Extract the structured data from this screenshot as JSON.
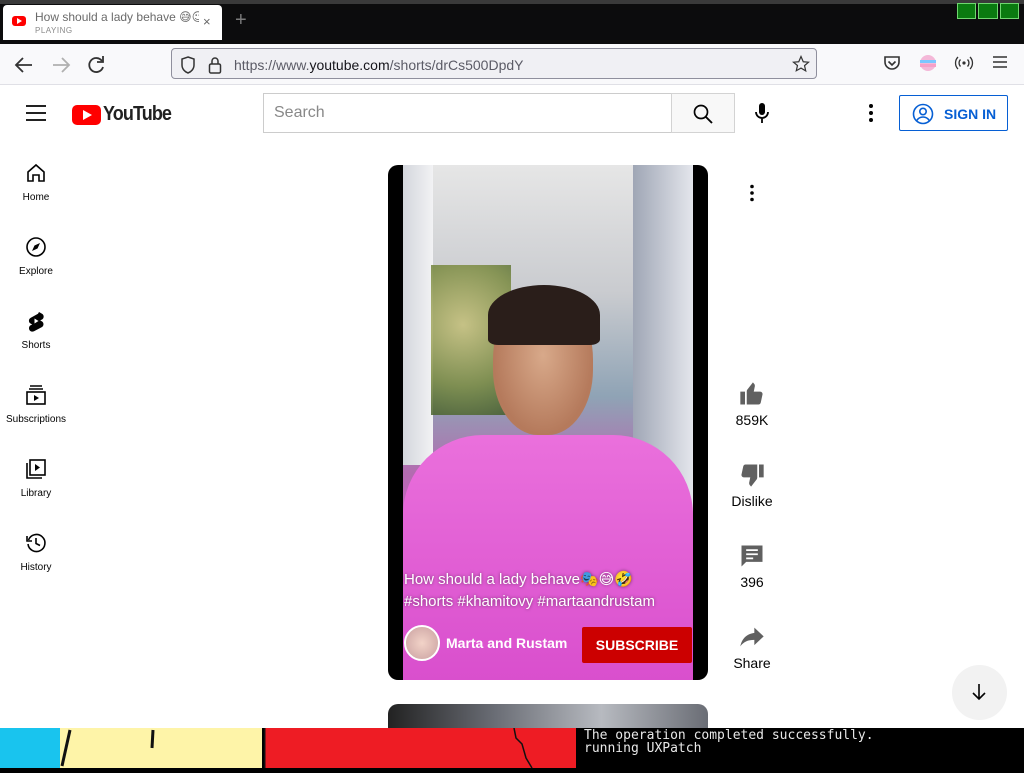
{
  "browser": {
    "tab": {
      "title": "How should a lady behave 😅😉",
      "status": "PLAYING",
      "close_glyph": "×"
    },
    "new_tab_glyph": "+",
    "url": {
      "prefix": "https://www.",
      "domain": "youtube.com",
      "path": "/shorts/drCs500DpdY"
    }
  },
  "youtube": {
    "logo_text": "YouTube",
    "search_placeholder": "Search",
    "sign_in_label": "SIGN IN",
    "sidebar": {
      "items": [
        {
          "label": "Home",
          "icon": "home-icon"
        },
        {
          "label": "Explore",
          "icon": "explore-icon"
        },
        {
          "label": "Shorts",
          "icon": "shorts-icon"
        },
        {
          "label": "Subscriptions",
          "icon": "subscriptions-icon"
        },
        {
          "label": "Library",
          "icon": "library-icon"
        },
        {
          "label": "History",
          "icon": "history-icon"
        }
      ]
    },
    "short": {
      "caption_line1": "How should a lady behave🎭😅🤣",
      "caption_line2": "#shorts #khamitovy #martaandrustam",
      "channel_name": "Marta and Rustam",
      "subscribe_label": "SUBSCRIBE"
    },
    "actions": {
      "likes": "859K",
      "dislike_label": "Dislike",
      "comments": "396",
      "share_label": "Share"
    }
  },
  "console": {
    "line1": "The operation completed successfully.",
    "line2": "running UXPatch"
  },
  "colors": {
    "brand_red": "#ff0000",
    "link_blue": "#065fd4",
    "subscribe_red": "#cc0000"
  }
}
